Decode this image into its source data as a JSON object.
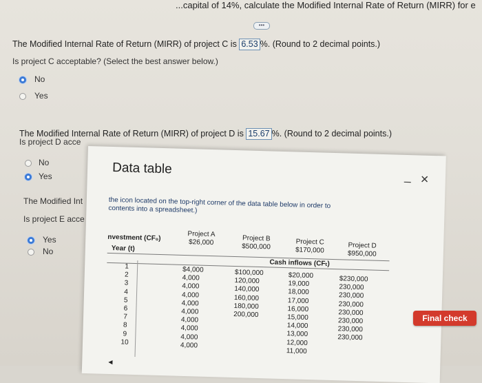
{
  "top_banner": "...capital of 14%, calculate the Modified Internal Rate of Return (MIRR) for e",
  "questions": {
    "c_mirr_prefix": "The Modified Internal Rate of Return (MIRR) of project C is",
    "c_mirr_value": "6.53",
    "c_mirr_suffix": "%. (Round to 2 decimal points.)",
    "c_accept": "Is project C acceptable? (Select the best answer below.)",
    "c_options": [
      "No",
      "Yes"
    ],
    "d_mirr_prefix": "The Modified Internal Rate of Return (MIRR) of project D is",
    "d_mirr_value": "15.67",
    "d_mirr_suffix": "%. (Round to 2 decimal points.)",
    "d_accept": "Is project D acce",
    "d_options": [
      "No",
      "Yes"
    ],
    "e_mirr_prefix": "The Modified Int",
    "e_accept": "Is project E acce",
    "e_options": [
      "Yes",
      "No"
    ]
  },
  "selected": {
    "c": "No",
    "d": "Yes",
    "e": "Yes"
  },
  "modal": {
    "title": "Data table",
    "minimize": "–",
    "close": "×",
    "intro_line1": "the icon located on the top-right corner of the data table below in order to",
    "intro_line2": "contents into a spreadsheet.)",
    "investment_label": "nvestment (CF₀)",
    "year_label": "Year (t)",
    "cash_inflows_label": "Cash inflows (CFₜ)",
    "projects": [
      {
        "name": "Project A",
        "investment": "$26,000"
      },
      {
        "name": "Project B",
        "investment": "$500,000"
      },
      {
        "name": "Project C",
        "investment": "$170,000"
      },
      {
        "name": "Project D",
        "investment": "$950,000"
      }
    ],
    "years": [
      "1",
      "2",
      "3",
      "4",
      "5",
      "6",
      "7",
      "8",
      "9",
      "10"
    ],
    "flows": {
      "a": [
        "$4,000",
        "4,000",
        "4,000",
        "4,000",
        "4,000",
        "4,000",
        "4,000",
        "4,000",
        "4,000",
        "4,000"
      ],
      "b": [
        "$100,000",
        "120,000",
        "140,000",
        "160,000",
        "180,000",
        "200,000"
      ],
      "c": [
        "$20,000",
        "19,000",
        "18,000",
        "17,000",
        "16,000",
        "15,000",
        "14,000",
        "13,000",
        "12,000",
        "11,000"
      ],
      "d": [
        "$230,000",
        "230,000",
        "230,000",
        "230,000",
        "230,000",
        "230,000",
        "230,000",
        "230,000"
      ]
    }
  },
  "final_check_label": "Final check"
}
